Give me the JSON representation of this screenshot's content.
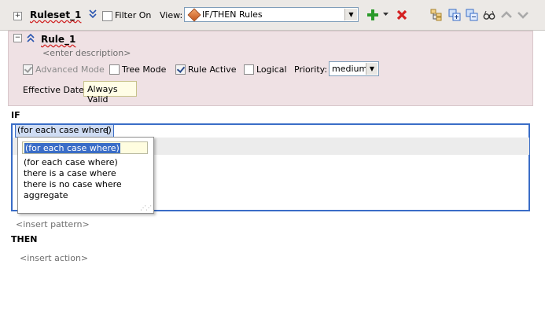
{
  "toolbar": {
    "ruleset_name": "Ruleset_1",
    "filter_label": "Filter On",
    "view_label": "View:",
    "view_value": "IF/THEN Rules"
  },
  "rule": {
    "name": "Rule_1",
    "description_placeholder": "<enter description>",
    "advanced_mode_label": "Advanced Mode",
    "tree_mode_label": "Tree Mode",
    "rule_active_label": "Rule Active",
    "logical_label": "Logical",
    "priority_label": "Priority:",
    "priority_value": "medium",
    "effective_date_label": "Effective Date:",
    "effective_date_value": "Always Valid"
  },
  "if_section": {
    "heading": "IF",
    "token": "(for each case where)",
    "brace": "{",
    "insert_pattern": "<insert pattern>"
  },
  "popup": {
    "input_value": "(for each case where)",
    "options": [
      "(for each case where)",
      "there is a case where",
      "there is no case where",
      "aggregate"
    ]
  },
  "then_section": {
    "heading": "THEN",
    "insert_action": "<insert action>"
  },
  "colors": {
    "toolbar_bg": "#ece9e6",
    "rule_panel_bg": "#efe1e4",
    "selection_blue": "#3a6dc7",
    "add_green": "#2a9a2a",
    "delete_red": "#d42020"
  },
  "icons": [
    "expand-icon",
    "collapse-chevron-icon",
    "add-icon",
    "delete-icon",
    "move-up-icon",
    "move-down-icon",
    "glasses-icon",
    "tree-icon",
    "expand-all-icon",
    "collapse-all-icon"
  ]
}
